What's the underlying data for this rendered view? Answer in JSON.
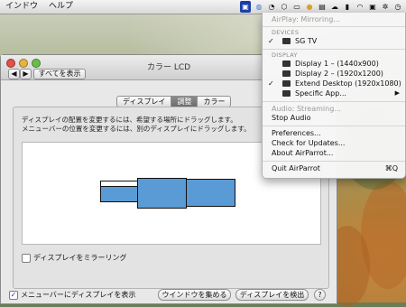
{
  "menubar": {
    "items": [
      "インドウ",
      "ヘルプ"
    ]
  },
  "window": {
    "title": "カラー LCD",
    "show_all": "すべてを表示",
    "tabs": [
      {
        "label": "ディスプレイ",
        "selected": false
      },
      {
        "label": "調整",
        "selected": true
      },
      {
        "label": "カラー",
        "selected": false
      }
    ],
    "instructions": [
      "ディスプレイの配置を変更するには、希望する場所にドラッグします。",
      "メニューバーの位置を変更するには、別のディスプレイにドラッグします。"
    ],
    "mirror_label": "ディスプレイをミラーリング",
    "mirror_checked": false,
    "show_menubar_label": "メニューバーにディスプレイを表示",
    "show_menubar_checked": true,
    "gather_button": "ウインドウを集める",
    "detect_button": "ディスプレイを検出",
    "help": "?"
  },
  "airparrot_menu": {
    "mirroring": "AirPlay: Mirroring...",
    "devices_header": "DEVICES",
    "device": "SG TV",
    "display_header": "DISPLAY",
    "displays": [
      {
        "label": "Display 1 – (1440x900)",
        "checked": false
      },
      {
        "label": "Display 2 – (1920x1200)",
        "checked": false
      },
      {
        "label": "Extend Desktop (1920x1080)",
        "checked": true
      },
      {
        "label": "Specific App...",
        "checked": false
      }
    ],
    "audio_streaming": "Audio: Streaming...",
    "stop_audio": "Stop Audio",
    "preferences": "Preferences...",
    "check_updates": "Check for Updates...",
    "about": "About AirParrot...",
    "quit": "Quit AirParrot",
    "quit_shortcut": "⌘Q",
    "check_mark": "✓",
    "submenu_arrow": "▶"
  }
}
